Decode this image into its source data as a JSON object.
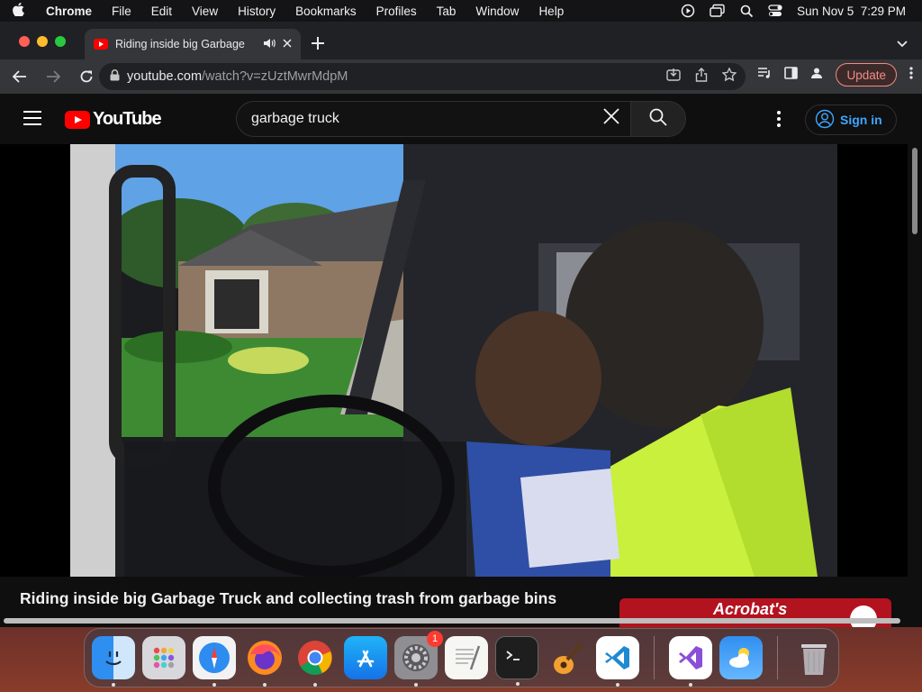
{
  "menubar": {
    "app_name": "Chrome",
    "items": [
      "File",
      "Edit",
      "View",
      "History",
      "Bookmarks",
      "Profiles",
      "Tab",
      "Window",
      "Help"
    ],
    "datetime": "Sun Nov 5  7:29 PM"
  },
  "browser": {
    "tab_title": "Riding inside big Garbage",
    "url_host": "youtube.com",
    "url_path": "/watch?v=zUztMwrMdpM",
    "update_label": "Update"
  },
  "youtube": {
    "logo_text": "YouTube",
    "search_value": "garbage truck",
    "signin_label": "Sign in",
    "video_title": "Riding inside big Garbage Truck and collecting trash from garbage bins",
    "ad_text": "Acrobat's"
  },
  "dock": {
    "apps": [
      "finder-icon",
      "launchpad-icon",
      "safari-icon",
      "firefox-icon",
      "chrome-icon",
      "app-store-icon",
      "system-settings-icon",
      "textedit-icon",
      "terminal-icon",
      "garageband-icon",
      "vscode-icon",
      "visual-studio-icon",
      "weather-icon",
      "trash-icon"
    ],
    "settings_badge": "1"
  },
  "colors": {
    "youtube_red": "#ff0000",
    "link_blue": "#3ea6ff",
    "update_red": "#f28b82"
  }
}
